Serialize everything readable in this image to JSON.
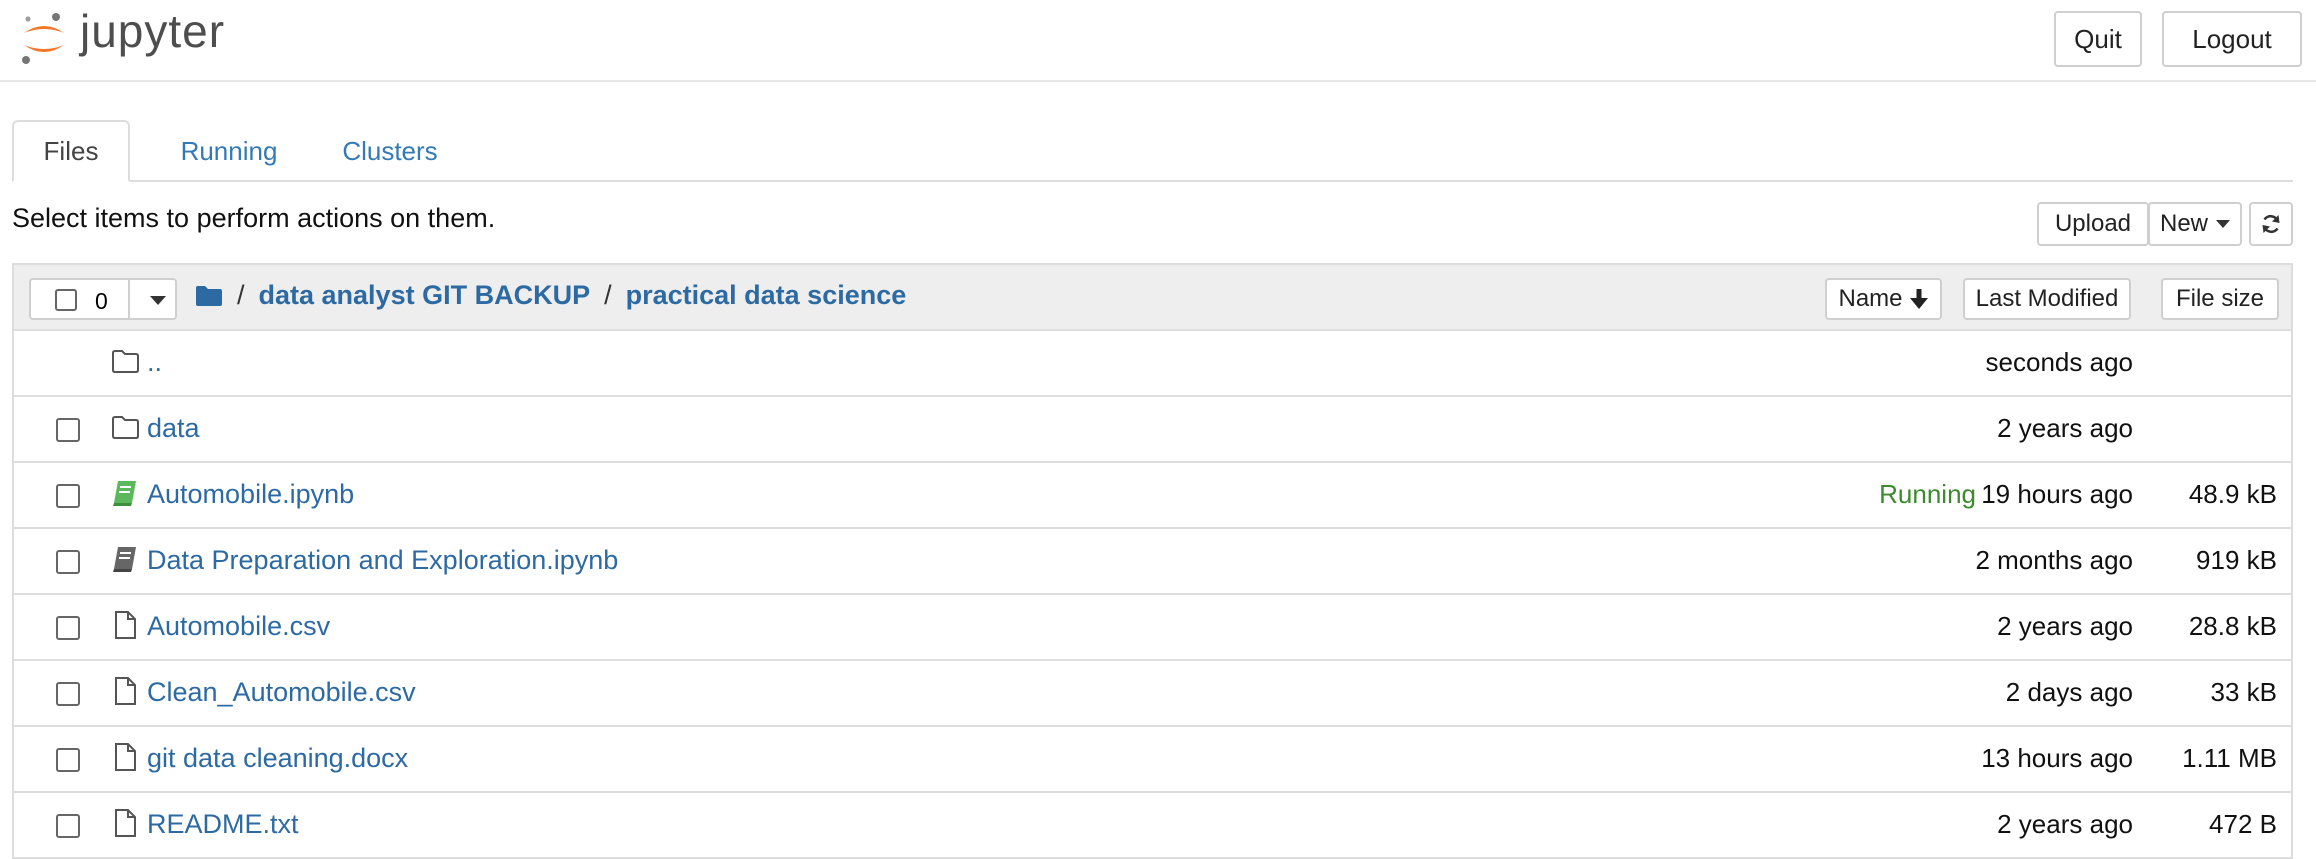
{
  "app": {
    "logo_text": "jupyter"
  },
  "header": {
    "quit_label": "Quit",
    "logout_label": "Logout"
  },
  "tabs": [
    {
      "label": "Files",
      "active": true
    },
    {
      "label": "Running",
      "active": false
    },
    {
      "label": "Clusters",
      "active": false
    }
  ],
  "toolbar": {
    "instructions": "Select items to perform actions on them.",
    "upload_label": "Upload",
    "new_label": "New",
    "refresh_icon": "refresh-icon"
  },
  "list_header": {
    "selected_count": "0",
    "breadcrumb_sep": "/",
    "breadcrumb": [
      "data analyst GIT BACKUP",
      "practical data science"
    ],
    "sort_name": "Name",
    "sort_modified": "Last Modified",
    "sort_size": "File size"
  },
  "files": [
    {
      "name": "..",
      "type": "folder",
      "status": "",
      "modified": "seconds ago",
      "size": ""
    },
    {
      "name": "data",
      "type": "folder",
      "status": "",
      "modified": "2 years ago",
      "size": ""
    },
    {
      "name": "Automobile.ipynb",
      "type": "notebook-running",
      "status": "Running",
      "modified": "19 hours ago",
      "size": "48.9 kB"
    },
    {
      "name": "Data Preparation and Exploration.ipynb",
      "type": "notebook",
      "status": "",
      "modified": "2 months ago",
      "size": "919 kB"
    },
    {
      "name": "Automobile.csv",
      "type": "file",
      "status": "",
      "modified": "2 years ago",
      "size": "28.8 kB"
    },
    {
      "name": "Clean_Automobile.csv",
      "type": "file",
      "status": "",
      "modified": "2 days ago",
      "size": "33 kB"
    },
    {
      "name": "git data cleaning.docx",
      "type": "file",
      "status": "",
      "modified": "13 hours ago",
      "size": "1.11 MB"
    },
    {
      "name": "README.txt",
      "type": "file",
      "status": "",
      "modified": "2 years ago",
      "size": "472 B"
    }
  ],
  "colors": {
    "link": "#2d6aa3",
    "running": "#3c8a2e",
    "logo_orange": "#f37726",
    "border": "#dddddd"
  }
}
